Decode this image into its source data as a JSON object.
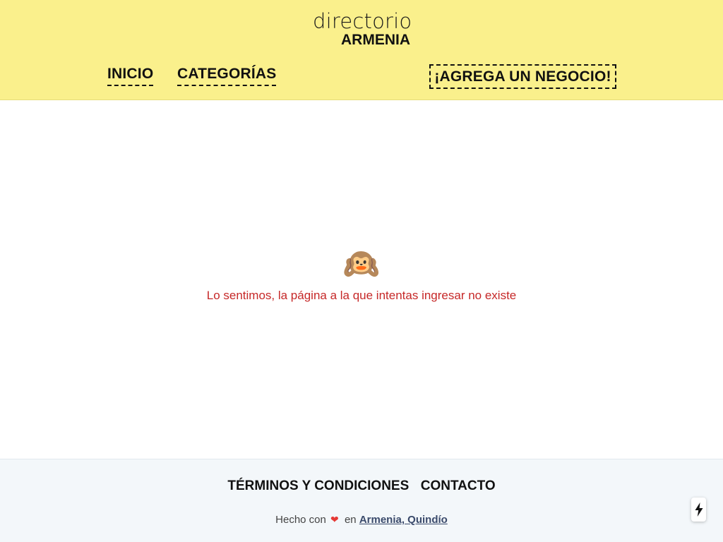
{
  "header": {
    "logo_top": "directorio",
    "logo_bottom": "ARMENIA",
    "nav": {
      "inicio": "INICIO",
      "categorias": "CATEGORÍAS"
    },
    "add_business": "¡AGREGA UN NEGOCIO!",
    "background": "#faf08c"
  },
  "main": {
    "emoji": "🙉",
    "error_message": "Lo sentimos, la página a la que intentas ingresar no existe",
    "error_color": "#c62828"
  },
  "footer": {
    "links": {
      "terms": "TÉRMINOS Y CONDICIONES",
      "contact": "CONTACTO"
    },
    "credit_prefix": "Hecho con",
    "heart": "❤",
    "credit_middle": "en",
    "location": "Armenia, Quindío",
    "background": "#f3f7fa"
  },
  "floating_button": {
    "icon": "lightning-icon"
  }
}
